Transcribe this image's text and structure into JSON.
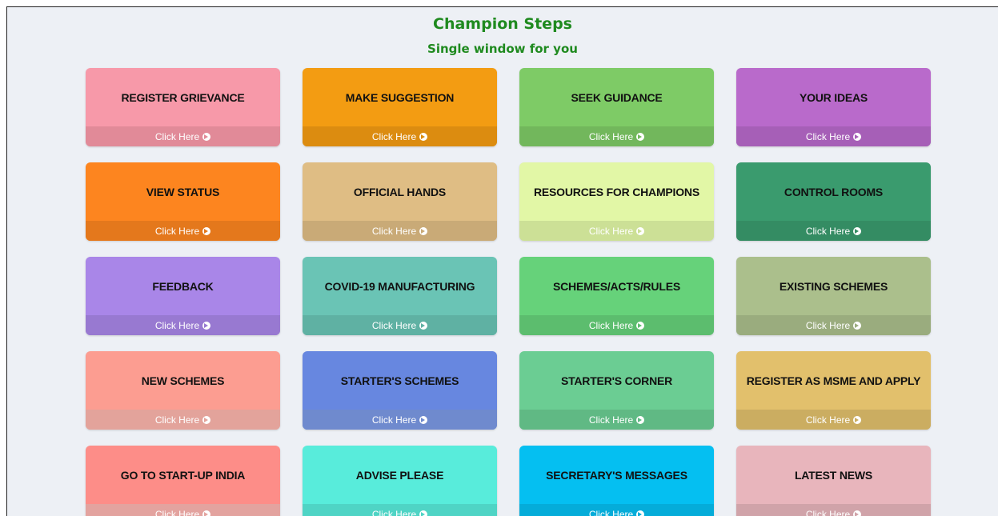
{
  "header": {
    "title": "Champion Steps",
    "subtitle": "Single window for you"
  },
  "cards": [
    {
      "label": "REGISTER GRIEVANCE",
      "action": "Click Here",
      "color": "#f799a9",
      "foot_color": "#e18a98",
      "icon": "arrow-circle-right-icon"
    },
    {
      "label": "MAKE SUGGESTION",
      "action": "Click Here",
      "color": "#f39c12",
      "foot_color": "#dc8c10",
      "icon": "arrow-circle-right-icon"
    },
    {
      "label": "SEEK GUIDANCE",
      "action": "Click Here",
      "color": "#7ecb66",
      "foot_color": "#72b75c",
      "icon": "arrow-circle-right-icon"
    },
    {
      "label": "YOUR IDEAS",
      "action": "Click Here",
      "color": "#b96acb",
      "foot_color": "#a65fb7",
      "icon": "arrow-circle-right-icon"
    },
    {
      "label": "VIEW STATUS",
      "action": "Click Here",
      "color": "#fd851f",
      "foot_color": "#e4781c",
      "icon": "arrow-circle-right-icon"
    },
    {
      "label": "OFFICIAL HANDS",
      "action": "Click Here",
      "color": "#dfbd84",
      "foot_color": "#c9aa77",
      "icon": "arrow-circle-right-icon"
    },
    {
      "label": "RESOURCES FOR CHAMPIONS",
      "action": "Click Here",
      "color": "#e2f7a6",
      "foot_color": "#cce096",
      "icon": "arrow-circle-right-icon"
    },
    {
      "label": "CONTROL ROOMS",
      "action": "Click Here",
      "color": "#3a9b6e",
      "foot_color": "#348c63",
      "icon": "arrow-circle-right-icon"
    },
    {
      "label": "FEEDBACK",
      "action": "Click Here",
      "color": "#a986e8",
      "foot_color": "#9879d1",
      "icon": "arrow-circle-right-icon"
    },
    {
      "label": "COVID-19 MANUFACTURING",
      "action": "Click Here",
      "color": "#6ac4b5",
      "foot_color": "#5fb1a3",
      "icon": "arrow-circle-right-icon"
    },
    {
      "label": "SCHEMES/ACTS/RULES",
      "action": "Click Here",
      "color": "#66d27a",
      "foot_color": "#5cbd6e",
      "icon": "arrow-circle-right-icon"
    },
    {
      "label": "EXISTING SCHEMES",
      "action": "Click Here",
      "color": "#abbf8c",
      "foot_color": "#9aac7e",
      "icon": "arrow-circle-right-icon"
    },
    {
      "label": "NEW SCHEMES",
      "action": "Click Here",
      "color": "#fc9d91",
      "foot_color": "#e3a39b",
      "icon": "arrow-circle-right-icon"
    },
    {
      "label": "STARTER'S SCHEMES",
      "action": "Click Here",
      "color": "#6787e0",
      "foot_color": "#6f8ace",
      "icon": "arrow-circle-right-icon"
    },
    {
      "label": "STARTER'S CORNER",
      "action": "Click Here",
      "color": "#6bcd93",
      "foot_color": "#60b984",
      "icon": "arrow-circle-right-icon"
    },
    {
      "label": "REGISTER AS MSME AND APPLY",
      "action": "Click Here",
      "color": "#e2c06c",
      "foot_color": "#cbad61",
      "icon": "arrow-circle-right-icon"
    },
    {
      "label": "GO TO START-UP INDIA",
      "action": "Click Here",
      "color": "#fd8d88",
      "foot_color": "#e3a39f",
      "icon": "arrow-circle-right-icon"
    },
    {
      "label": "ADVISE PLEASE",
      "action": "Click Here",
      "color": "#58ecdb",
      "foot_color": "#4fd4c5",
      "icon": "arrow-circle-right-icon"
    },
    {
      "label": "SECRETARY'S MESSAGES",
      "action": "Click Here",
      "color": "#05bff1",
      "foot_color": "#05acd9",
      "icon": "arrow-circle-right-icon"
    },
    {
      "label": "LATEST NEWS",
      "action": "Click Here",
      "color": "#e8b5bc",
      "foot_color": "#d0a3a9",
      "icon": "arrow-circle-right-icon"
    }
  ]
}
